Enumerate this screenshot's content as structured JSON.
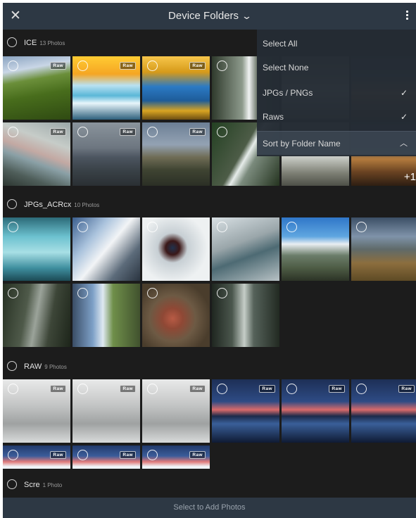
{
  "header": {
    "title": "Device Folders",
    "close_icon": "close-icon",
    "more_icon": "more-vertical-icon"
  },
  "menu": {
    "items": [
      {
        "label": "Select All",
        "checked": false
      },
      {
        "label": "Select None",
        "checked": false
      },
      {
        "label": "JPGs / PNGs",
        "checked": true
      },
      {
        "label": "Raws",
        "checked": true
      },
      {
        "label": "Sort by Folder Name",
        "expanded": true
      }
    ]
  },
  "sections": [
    {
      "name": "ICE",
      "count": "13 Photos",
      "overflow_badge": "+1"
    },
    {
      "name": "JPGs_ACRcx",
      "count": "10 Photos"
    },
    {
      "name": "RAW",
      "count": "9 Photos"
    },
    {
      "name": "Scre",
      "count": "1 Photo"
    }
  ],
  "raw_badge": "Raw",
  "footer": {
    "label": "Select to Add Photos"
  }
}
